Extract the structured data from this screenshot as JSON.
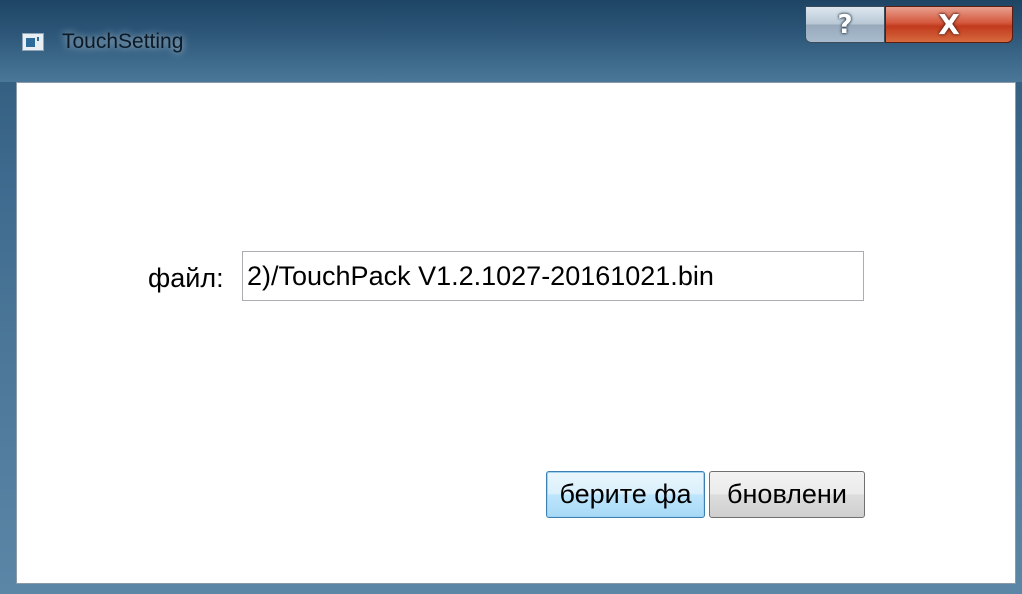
{
  "window": {
    "title": "TouchSetting",
    "help_glyph": "?",
    "close_glyph": "X",
    "icon": "app-window-icon"
  },
  "form": {
    "file_label": "файл:",
    "file_path_value": "2)/TouchPack V1.2.1027-20161021.bin"
  },
  "buttons": {
    "select_file_label": "берите фа",
    "update_label": "бновлени"
  },
  "colors": {
    "close_button": "#c23a1e",
    "focused_button_border": "#3c7fb1"
  }
}
